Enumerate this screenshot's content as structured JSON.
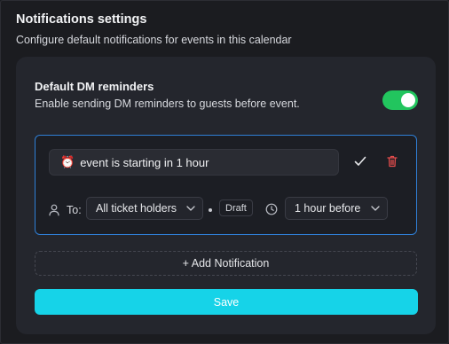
{
  "header": {
    "title": "Notifications settings",
    "subtitle": "Configure default notifications for events in this calendar"
  },
  "dm_reminders": {
    "title": "Default DM reminders",
    "description": "Enable sending DM reminders to guests before event.",
    "enabled": true,
    "toggle_color": "#22c55e"
  },
  "reminder": {
    "icon": "alarm-clock-icon",
    "message": "event is starting in 1 hour",
    "to_label": "To:",
    "recipients": "All ticket holders",
    "status": "Draft",
    "offset": "1 hour before",
    "border_color": "#2f7fd6",
    "delete_color": "#e24c4c"
  },
  "actions": {
    "add_label": "+ Add Notification",
    "save_label": "Save",
    "save_color": "#16d3e8"
  }
}
